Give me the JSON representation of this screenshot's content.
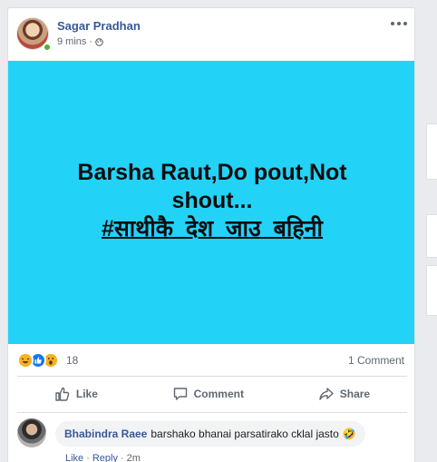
{
  "post": {
    "author": "Sagar Pradhan",
    "time": "9 mins",
    "meta_sep": "·",
    "image_text": {
      "line1": "Barsha Raut,Do pout,Not",
      "line2": "shout...",
      "hashtag": "#साथीकै_देश_जाउ_बहिनी"
    },
    "image_bg": "#23d2f7",
    "reactions": {
      "count": "18",
      "types": [
        "haha",
        "like",
        "wow"
      ]
    },
    "comment_count": "1 Comment",
    "actions": {
      "like": "Like",
      "comment": "Comment",
      "share": "Share"
    }
  },
  "comment": {
    "name": "Bhabindra Raee",
    "text": "barshako bhanai parsatirako cklal jasto",
    "emoji": "🤣",
    "like": "Like",
    "sep": "·",
    "reply": "Reply",
    "time": "2m"
  },
  "colors": {
    "link": "#385898",
    "muted": "#606770",
    "online": "#42b72a"
  }
}
